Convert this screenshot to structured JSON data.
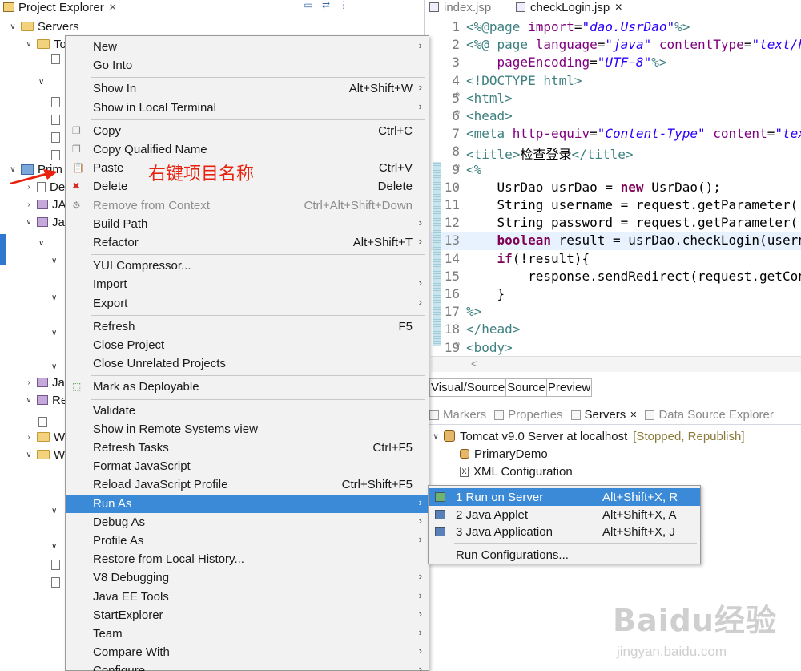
{
  "explorer": {
    "tab_label": "Project Explorer",
    "tree": [
      {
        "label": "Servers",
        "indent": 1,
        "twisty": "expanded",
        "icon": "folder-icon"
      },
      {
        "label": "To",
        "indent": 2,
        "twisty": "expanded",
        "icon": "folder-icon"
      },
      {
        "label": "Prim",
        "indent": 1,
        "twisty": "expanded",
        "icon": "project-icon"
      },
      {
        "label": "De",
        "indent": 2,
        "twisty": "collapsed",
        "icon": "deployment-icon"
      },
      {
        "label": "JA",
        "indent": 2,
        "twisty": "collapsed",
        "icon": "jax-icon"
      },
      {
        "label": "Ja",
        "indent": 2,
        "twisty": "expanded",
        "icon": "java-resources-icon"
      },
      {
        "label": "Ja",
        "indent": 2,
        "twisty": "collapsed",
        "icon": "library-icon"
      },
      {
        "label": "Re",
        "indent": 2,
        "twisty": "expanded",
        "icon": "library-icon"
      },
      {
        "label": "W",
        "indent": 2,
        "twisty": "collapsed",
        "icon": "folder-icon"
      },
      {
        "label": "W",
        "indent": 2,
        "twisty": "expanded",
        "icon": "folder-icon"
      }
    ]
  },
  "annotation": "右键项目名称",
  "context_menu": {
    "items": [
      {
        "label": "New",
        "shortcut": "",
        "submenu": true
      },
      {
        "label": "Go Into",
        "shortcut": "",
        "submenu": false
      },
      {
        "sep": true
      },
      {
        "label": "Show In",
        "shortcut": "Alt+Shift+W",
        "submenu": true
      },
      {
        "label": "Show in Local Terminal",
        "shortcut": "",
        "submenu": true
      },
      {
        "sep": true
      },
      {
        "label": "Copy",
        "shortcut": "Ctrl+C",
        "submenu": false,
        "icon": "copy-icon"
      },
      {
        "label": "Copy Qualified Name",
        "shortcut": "",
        "submenu": false,
        "icon": "copy-qualified-icon"
      },
      {
        "label": "Paste",
        "shortcut": "Ctrl+V",
        "submenu": false,
        "icon": "paste-icon"
      },
      {
        "label": "Delete",
        "shortcut": "Delete",
        "submenu": false,
        "icon": "delete-icon"
      },
      {
        "label": "Remove from Context",
        "shortcut": "Ctrl+Alt+Shift+Down",
        "submenu": false,
        "disabled": true,
        "icon": "remove-context-icon"
      },
      {
        "label": "Build Path",
        "shortcut": "",
        "submenu": true
      },
      {
        "label": "Refactor",
        "shortcut": "Alt+Shift+T",
        "submenu": true
      },
      {
        "sep": true
      },
      {
        "label": "YUI Compressor...",
        "shortcut": "",
        "submenu": false
      },
      {
        "label": "Import",
        "shortcut": "",
        "submenu": true
      },
      {
        "label": "Export",
        "shortcut": "",
        "submenu": true
      },
      {
        "sep": true
      },
      {
        "label": "Refresh",
        "shortcut": "F5",
        "submenu": false
      },
      {
        "label": "Close Project",
        "shortcut": "",
        "submenu": false
      },
      {
        "label": "Close Unrelated Projects",
        "shortcut": "",
        "submenu": false
      },
      {
        "sep": true
      },
      {
        "label": "Mark as Deployable",
        "shortcut": "",
        "submenu": false,
        "icon": "deployable-icon"
      },
      {
        "sep": true
      },
      {
        "label": "Validate",
        "shortcut": "",
        "submenu": false
      },
      {
        "label": "Show in Remote Systems view",
        "shortcut": "",
        "submenu": false
      },
      {
        "label": "Refresh Tasks",
        "shortcut": "Ctrl+F5",
        "submenu": false
      },
      {
        "label": "Format JavaScript",
        "shortcut": "",
        "submenu": false
      },
      {
        "label": "Reload JavaScript Profile",
        "shortcut": "Ctrl+Shift+F5",
        "submenu": false
      },
      {
        "label": "Run As",
        "shortcut": "",
        "submenu": true,
        "selected": true
      },
      {
        "label": "Debug As",
        "shortcut": "",
        "submenu": true
      },
      {
        "label": "Profile As",
        "shortcut": "",
        "submenu": true
      },
      {
        "label": "Restore from Local History...",
        "shortcut": "",
        "submenu": false
      },
      {
        "label": "V8 Debugging",
        "shortcut": "",
        "submenu": true
      },
      {
        "label": "Java EE Tools",
        "shortcut": "",
        "submenu": true
      },
      {
        "label": "StartExplorer",
        "shortcut": "",
        "submenu": true
      },
      {
        "label": "Team",
        "shortcut": "",
        "submenu": true
      },
      {
        "label": "Compare With",
        "shortcut": "",
        "submenu": true
      },
      {
        "label": "Configure",
        "shortcut": "",
        "submenu": true
      }
    ]
  },
  "editor": {
    "tabs": [
      {
        "label": "index.jsp",
        "active": false
      },
      {
        "label": "checkLogin.jsp",
        "active": true
      }
    ],
    "lines": [
      {
        "n": "1",
        "fold": "",
        "tokens": [
          [
            "tag",
            "<%@"
          ],
          [
            "kw",
            "page "
          ],
          [
            "attr",
            "import"
          ],
          [
            "plain",
            "="
          ],
          [
            "str",
            "\"dao.UsrDao\""
          ],
          [
            "tag",
            "%>"
          ]
        ]
      },
      {
        "n": "2",
        "fold": "",
        "tokens": [
          [
            "tag",
            "<%@ "
          ],
          [
            "kw",
            "page "
          ],
          [
            "attr",
            "language"
          ],
          [
            "plain",
            "="
          ],
          [
            "str",
            "\"java\" "
          ],
          [
            "attr",
            "contentType"
          ],
          [
            "plain",
            "="
          ],
          [
            "str",
            "\"text/h"
          ]
        ]
      },
      {
        "n": "3",
        "fold": "",
        "tokens": [
          [
            "plain",
            "    "
          ],
          [
            "attr",
            "pageEncoding"
          ],
          [
            "plain",
            "="
          ],
          [
            "str",
            "\"UTF-8\""
          ],
          [
            "tag",
            "%>"
          ]
        ]
      },
      {
        "n": "4",
        "fold": "",
        "tokens": [
          [
            "tag",
            "<!DOCTYPE "
          ],
          [
            "kw",
            "html"
          ],
          [
            "tag",
            ">"
          ]
        ]
      },
      {
        "n": "5",
        "fold": "⊖",
        "tokens": [
          [
            "tag",
            "<html>"
          ]
        ]
      },
      {
        "n": "6",
        "fold": "⊖",
        "tokens": [
          [
            "tag",
            "<head>"
          ]
        ]
      },
      {
        "n": "7",
        "fold": "",
        "tokens": [
          [
            "tag",
            "<meta "
          ],
          [
            "attr",
            "http-equiv"
          ],
          [
            "plain",
            "="
          ],
          [
            "str",
            "\"Content-Type\" "
          ],
          [
            "attr",
            "content"
          ],
          [
            "plain",
            "="
          ],
          [
            "str",
            "\"tex"
          ]
        ]
      },
      {
        "n": "8",
        "fold": "",
        "tokens": [
          [
            "tag",
            "<title>"
          ],
          [
            "plain",
            "检查登录"
          ],
          [
            "tag",
            "</title>"
          ]
        ]
      },
      {
        "n": "9",
        "fold": "⊖",
        "tokens": [
          [
            "tag",
            "<%"
          ]
        ]
      },
      {
        "n": "10",
        "fold": "",
        "tokens": [
          [
            "plain",
            "    UsrDao usrDao = "
          ],
          [
            "jkw",
            "new"
          ],
          [
            "plain",
            " UsrDao();"
          ]
        ]
      },
      {
        "n": "11",
        "fold": "",
        "tokens": [
          [
            "plain",
            "    String username = request.getParameter("
          ]
        ]
      },
      {
        "n": "12",
        "fold": "",
        "tokens": [
          [
            "plain",
            "    String password = request.getParameter("
          ]
        ]
      },
      {
        "n": "13",
        "fold": "",
        "hl": true,
        "tokens": [
          [
            "plain",
            "    "
          ],
          [
            "jkw",
            "boolean"
          ],
          [
            "plain",
            " result = usrDao.checkLogin(usern"
          ]
        ]
      },
      {
        "n": "14",
        "fold": "",
        "tokens": [
          [
            "plain",
            "    "
          ],
          [
            "jkw",
            "if"
          ],
          [
            "plain",
            "(!result){"
          ]
        ]
      },
      {
        "n": "15",
        "fold": "",
        "tokens": [
          [
            "plain",
            "        response.sendRedirect(request.getCon"
          ]
        ]
      },
      {
        "n": "16",
        "fold": "",
        "tokens": [
          [
            "plain",
            "    }"
          ]
        ]
      },
      {
        "n": "17",
        "fold": "",
        "tokens": [
          [
            "tag",
            "%>"
          ]
        ]
      },
      {
        "n": "18",
        "fold": "",
        "tokens": [
          [
            "tag",
            "</head>"
          ]
        ]
      },
      {
        "n": "19",
        "fold": "⊖",
        "tokens": [
          [
            "tag",
            "<body>"
          ]
        ]
      }
    ],
    "scroll_left_glyph": "<",
    "mode_tabs": [
      "Visual/Source",
      "Source",
      "Preview"
    ]
  },
  "views": {
    "tabs": [
      {
        "label": "Markers",
        "active": false,
        "icon": "markers-icon"
      },
      {
        "label": "Properties",
        "active": false,
        "icon": "properties-icon"
      },
      {
        "label": "Servers",
        "active": true,
        "icon": "servers-icon"
      },
      {
        "label": "Data Source Explorer",
        "active": false,
        "icon": "data-source-icon"
      }
    ],
    "server_name": "Tomcat v9.0 Server at localhost",
    "server_status": "[Stopped, Republish]",
    "children": [
      "PrimaryDemo",
      "XML Configuration"
    ]
  },
  "submenu": {
    "items": [
      {
        "label": "1 Run on Server",
        "shortcut": "Alt+Shift+X, R",
        "selected": true,
        "icon": "run-on-server-icon"
      },
      {
        "label": "2 Java Applet",
        "shortcut": "Alt+Shift+X, A",
        "icon": "java-applet-icon"
      },
      {
        "label": "3 Java Application",
        "shortcut": "Alt+Shift+X, J",
        "icon": "java-application-icon"
      },
      {
        "sep": true
      },
      {
        "label": "Run Configurations...",
        "shortcut": ""
      }
    ]
  },
  "watermark": {
    "logo": "Baidu经验",
    "url": "jingyan.baidu.com"
  },
  "colors": {
    "menu_bg": "#f2f2f2",
    "selection": "#3b8ad8",
    "annotation": "#e8220e",
    "code_tag": "#3e8080",
    "code_attr": "#7f007f",
    "code_string": "#2a00ff",
    "code_keyword": "#7f0055"
  }
}
